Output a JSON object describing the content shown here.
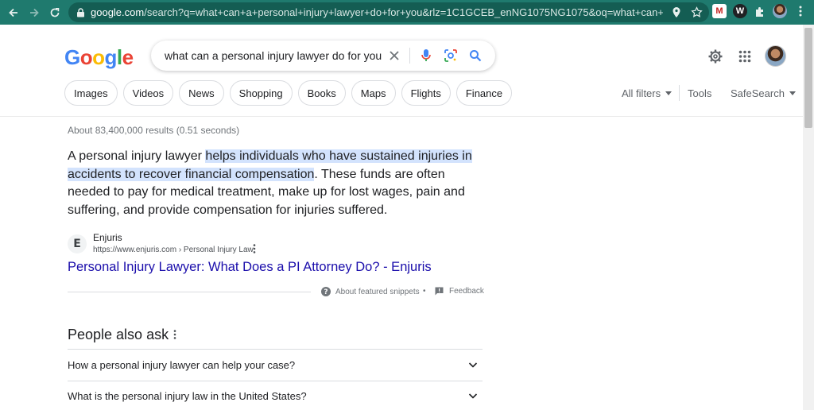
{
  "browser": {
    "url_host": "google.com",
    "url_rest": "/search?q=what+can+a+personal+injury+lawyer+do+for+you&rlz=1C1GCEB_enNG1075NG1075&oq=what+can+a+personal+inj..."
  },
  "search": {
    "logo": [
      "G",
      "o",
      "o",
      "g",
      "l",
      "e"
    ],
    "query": "what can a personal injury lawyer do for you"
  },
  "chips": [
    "Images",
    "Videos",
    "News",
    "Shopping",
    "Books",
    "Maps",
    "Flights",
    "Finance"
  ],
  "tools": {
    "all_filters": "All filters",
    "tools": "Tools",
    "safesearch": "SafeSearch"
  },
  "results": {
    "stats": "About 83,400,000 results (0.51 seconds)",
    "snippet_pre": "A personal injury lawyer ",
    "snippet_highlight": "helps individuals who have sustained injuries in accidents to recover financial compensation",
    "snippet_post": ". These funds are often needed to pay for medical treatment, make up for lost wages, pain and suffering, and provide compensation for injuries suffered.",
    "source_letter": "E",
    "source_name": "Enjuris",
    "source_url": "https://www.enjuris.com › Personal Injury Law",
    "link_title": "Personal Injury Lawyer: What Does a PI Attorney Do? - Enjuris",
    "about_snippets": "About featured snippets",
    "feedback": "Feedback",
    "separator": "•"
  },
  "people_also_ask": {
    "title": "People also ask",
    "questions": [
      "How a personal injury lawyer can help your case?",
      "What is the personal injury law in the United States?"
    ]
  },
  "colors": {
    "chrome_bar": "#1f7a6e",
    "link": "#1a0dab",
    "highlight": "#d3e3fd",
    "google_blue": "#4285f4",
    "google_red": "#ea4335",
    "google_yellow": "#fbbc05",
    "google_green": "#34a853"
  }
}
